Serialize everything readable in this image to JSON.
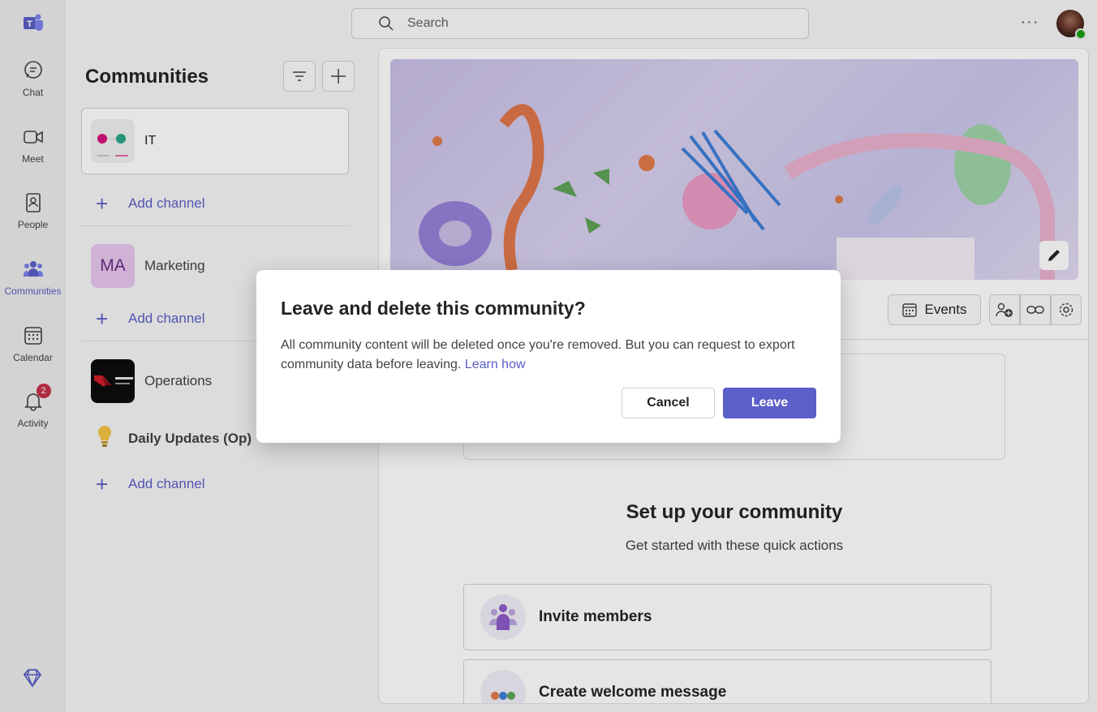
{
  "rail": {
    "items": [
      {
        "label": "Chat",
        "icon": "chat-icon"
      },
      {
        "label": "Meet",
        "icon": "video-icon"
      },
      {
        "label": "People",
        "icon": "people-icon"
      },
      {
        "label": "Communities",
        "icon": "communities-icon",
        "active": true
      },
      {
        "label": "Calendar",
        "icon": "calendar-icon"
      },
      {
        "label": "Activity",
        "icon": "bell-icon",
        "badge": "2"
      }
    ],
    "accent": "#5b5fc7"
  },
  "search": {
    "placeholder": "Search"
  },
  "pane": {
    "title": "Communities",
    "communities": [
      {
        "name": "IT",
        "add_channel": "Add channel"
      },
      {
        "name": "Marketing",
        "initials": "MA",
        "add_channel": "Add channel"
      },
      {
        "name": "Operations",
        "channel": "Daily Updates (Op)",
        "add_channel": "Add channel"
      }
    ]
  },
  "main": {
    "events_label": "Events",
    "setup_title": "Set up your community",
    "setup_sub": "Get started with these quick actions",
    "actions": [
      {
        "label": "Invite members"
      },
      {
        "label": "Create welcome message"
      }
    ]
  },
  "dialog": {
    "title": "Leave and delete this community?",
    "body": "All community content will be deleted once you're removed. But you can request to export community data before leaving.",
    "link": "Learn how",
    "cancel": "Cancel",
    "leave": "Leave"
  }
}
